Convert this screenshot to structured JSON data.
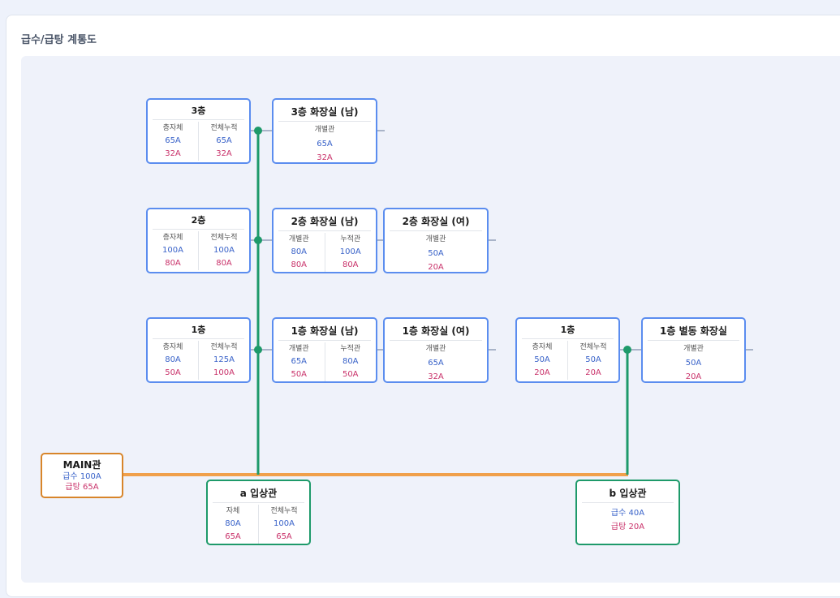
{
  "panel": {
    "title": "급수/급탕 계통도"
  },
  "colors": {
    "supply": "#3a63c9",
    "hot": "#c9326a",
    "riser": "#1e9a6a",
    "main_line": "#f0a04b",
    "node_border": "#5b8def"
  },
  "floors": [
    {
      "title": "3층",
      "col1_label": "층자체",
      "col1_supply": "65A",
      "col1_hot": "32A",
      "col2_label": "전체누적",
      "col2_supply": "65A",
      "col2_hot": "32A"
    },
    {
      "title": "2층",
      "col1_label": "층자체",
      "col1_supply": "100A",
      "col1_hot": "80A",
      "col2_label": "전체누적",
      "col2_supply": "100A",
      "col2_hot": "80A"
    },
    {
      "title": "1층",
      "col1_label": "층자체",
      "col1_supply": "80A",
      "col1_hot": "50A",
      "col2_label": "전체누적",
      "col2_supply": "125A",
      "col2_hot": "100A"
    }
  ],
  "rooms": {
    "r3m": {
      "title": "3층 화장실 (남)",
      "label": "개별관",
      "supply": "65A",
      "hot": "32A"
    },
    "r2m": {
      "title": "2층 화장실 (남)",
      "col1_label": "개별관",
      "col1_supply": "80A",
      "col1_hot": "80A",
      "col2_label": "누적관",
      "col2_supply": "100A",
      "col2_hot": "80A"
    },
    "r2f": {
      "title": "2층 화장실 (여)",
      "label": "개별관",
      "supply": "50A",
      "hot": "20A"
    },
    "r1m": {
      "title": "1층 화장실 (남)",
      "col1_label": "개별관",
      "col1_supply": "65A",
      "col1_hot": "50A",
      "col2_label": "누적관",
      "col2_supply": "80A",
      "col2_hot": "50A"
    },
    "r1f": {
      "title": "1층 화장실 (여)",
      "label": "개별관",
      "supply": "65A",
      "hot": "32A"
    },
    "annexFloor": {
      "title": "1층",
      "col1_label": "층자체",
      "col1_supply": "50A",
      "col1_hot": "20A",
      "col2_label": "전체누적",
      "col2_supply": "50A",
      "col2_hot": "20A"
    },
    "annexRoom": {
      "title": "1층 별동 화장실",
      "label": "개별관",
      "supply": "50A",
      "hot": "20A"
    }
  },
  "main": {
    "title": "MAIN관",
    "supply": "급수 100A",
    "hot": "급탕 65A"
  },
  "riserA": {
    "title": "a 입상관",
    "col1_label": "자체",
    "col1_supply": "80A",
    "col1_hot": "65A",
    "col2_label": "전체누적",
    "col2_supply": "100A",
    "col2_hot": "65A"
  },
  "riserB": {
    "title": "b 입상관",
    "supply": "급수 40A",
    "hot": "급탕 20A"
  }
}
